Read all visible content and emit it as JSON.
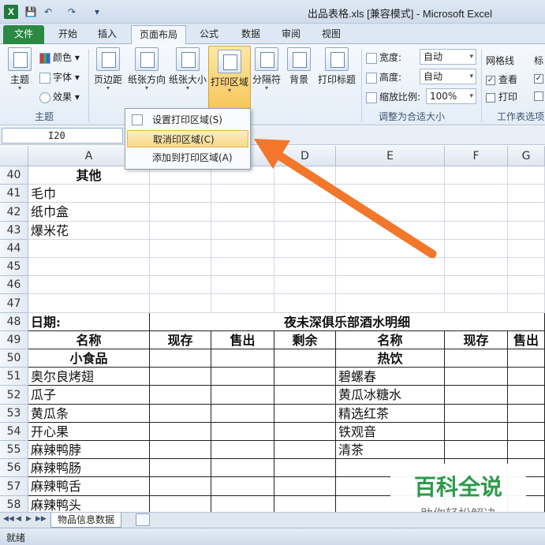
{
  "window": {
    "title": "出品表格.xls  [兼容模式] - Microsoft Excel",
    "app_icon": "X"
  },
  "qat": {
    "save_icon": "💾",
    "undo_icon": "↶",
    "redo_icon": "↷",
    "customize_icon": "▾"
  },
  "tabs": [
    "文件",
    "开始",
    "插入",
    "页面布局",
    "公式",
    "数据",
    "审阅",
    "视图"
  ],
  "ribbon": {
    "theme": "主题",
    "colors": "颜色",
    "fonts": "字体",
    "effects": "效果",
    "theme_group": "主题",
    "margins": "页边距",
    "orientation": "纸张方向",
    "size": "纸张大小",
    "print_area": "打印区域",
    "breaks": "分隔符",
    "background": "背景",
    "print_titles": "打印标题",
    "width_label": "宽度:",
    "width_value": "自动",
    "height_label": "高度:",
    "height_value": "自动",
    "scale_label": "缩放比例:",
    "scale_value": "100%",
    "fit_group": "调整为合适大小",
    "gridlines": "网格线",
    "view": "查看",
    "print": "打印",
    "headings": "标",
    "sheet_options_group": "工作表选项"
  },
  "namebox": {
    "value": "I20"
  },
  "menu": {
    "items": [
      {
        "label": "设置打印区域(S)",
        "highlighted": false
      },
      {
        "label": "取消印区域(C)",
        "highlighted": true
      },
      {
        "label": "添加到打印区域(A)",
        "highlighted": false
      }
    ]
  },
  "columns": [
    "A",
    "B",
    "C",
    "D",
    "E",
    "F",
    "G"
  ],
  "rows": [
    {
      "num": "40",
      "a": "其他"
    },
    {
      "num": "41",
      "a": "毛巾"
    },
    {
      "num": "42",
      "a": "纸巾盒"
    },
    {
      "num": "43",
      "a": "爆米花"
    },
    {
      "num": "44"
    },
    {
      "num": "45"
    },
    {
      "num": "46"
    },
    {
      "num": "47"
    },
    {
      "num": "48",
      "a": "日期:",
      "title": "夜未深俱乐部酒水明细"
    },
    {
      "num": "49",
      "a": "名称",
      "b": "现存",
      "c": "售出",
      "d": "剩余",
      "e": "名称",
      "f": "现存",
      "g": "售出"
    },
    {
      "num": "50",
      "a": "小食品",
      "e": "热饮"
    },
    {
      "num": "51",
      "a": "奥尔良烤翅",
      "e": "碧螺春"
    },
    {
      "num": "52",
      "a": "瓜子",
      "e": "黄瓜冰糖水"
    },
    {
      "num": "53",
      "a": "黄瓜条",
      "e": "精选红茶"
    },
    {
      "num": "54",
      "a": "开心果",
      "e": "铁观音"
    },
    {
      "num": "55",
      "a": "麻辣鸭脖",
      "e": "清茶"
    },
    {
      "num": "56",
      "a": "麻辣鸭肠"
    },
    {
      "num": "57",
      "a": "麻辣鸭舌"
    },
    {
      "num": "58",
      "a": "麻辣鸭头"
    }
  ],
  "sheet": {
    "tab": "物品信息数据",
    "nav": [
      "◀◀",
      "◀",
      "▶",
      "▶▶"
    ]
  },
  "status": {
    "text": "就绪"
  },
  "watermark": {
    "title": "百科全说",
    "subtitle": "助你轻松解决"
  },
  "colors": {
    "arrow": "#f2772b",
    "file_tab": "#2a8a43",
    "watermark": "#2c9a4a"
  }
}
